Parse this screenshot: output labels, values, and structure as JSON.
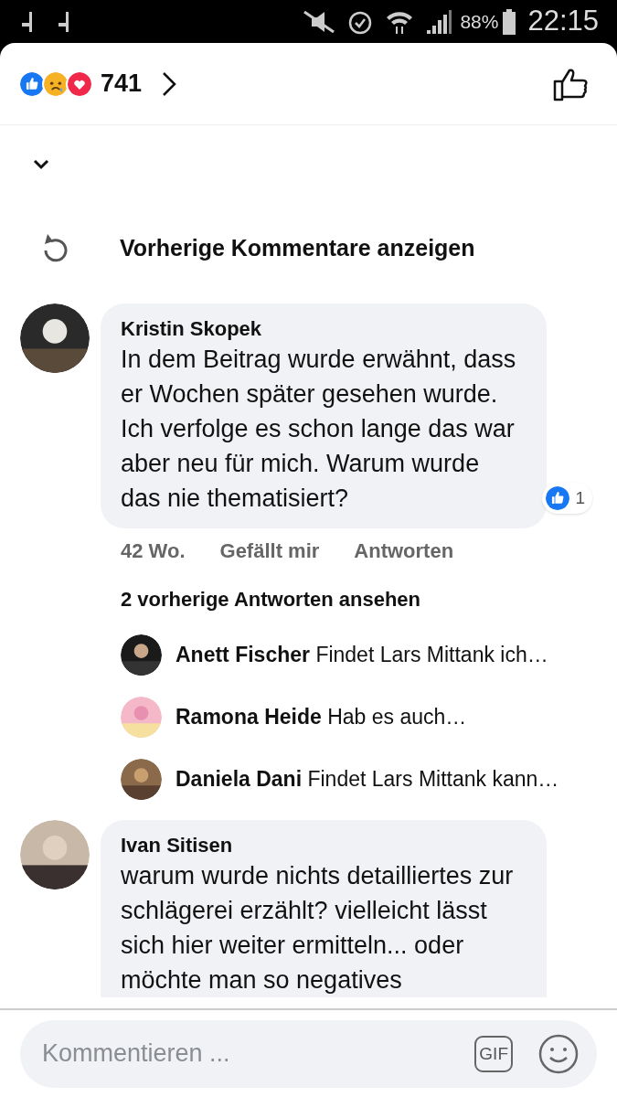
{
  "status_bar": {
    "battery": "88%",
    "time": "22:15"
  },
  "header": {
    "reactions": [
      {
        "kind": "like"
      },
      {
        "kind": "sad"
      },
      {
        "kind": "love"
      }
    ],
    "count": "741",
    "liked": false
  },
  "previous_comments": "Vorherige Kommentare anzeigen",
  "comments": [
    {
      "author": "Kristin Skopek",
      "text": "In dem Beitrag wurde erwähnt, dass er Wochen später gesehen wurde. Ich verfolge es schon lange das war aber neu für mich. Warum wurde das nie thematisiert?",
      "reaction_count": "1",
      "time": "42 Wo.",
      "like_label": "Gefällt mir",
      "reply_label": "Antworten",
      "more_replies": "2 vorherige Antworten ansehen",
      "replies": [
        {
          "author": "Anett Fischer",
          "text": "Findet Lars Mittank ich…"
        },
        {
          "author": "Ramona Heide",
          "text": "Hab es auch…"
        },
        {
          "author": "Daniela Dani",
          "text": "Findet Lars Mittank kann…"
        }
      ]
    },
    {
      "author": "Ivan Sitisen",
      "text": "warum wurde nichts detailliertes zur schlägerei erzählt? vielleicht lässt sich hier weiter ermitteln... oder möchte man so negatives"
    }
  ],
  "composer": {
    "placeholder": "Kommentieren ...",
    "gif": "GIF"
  }
}
